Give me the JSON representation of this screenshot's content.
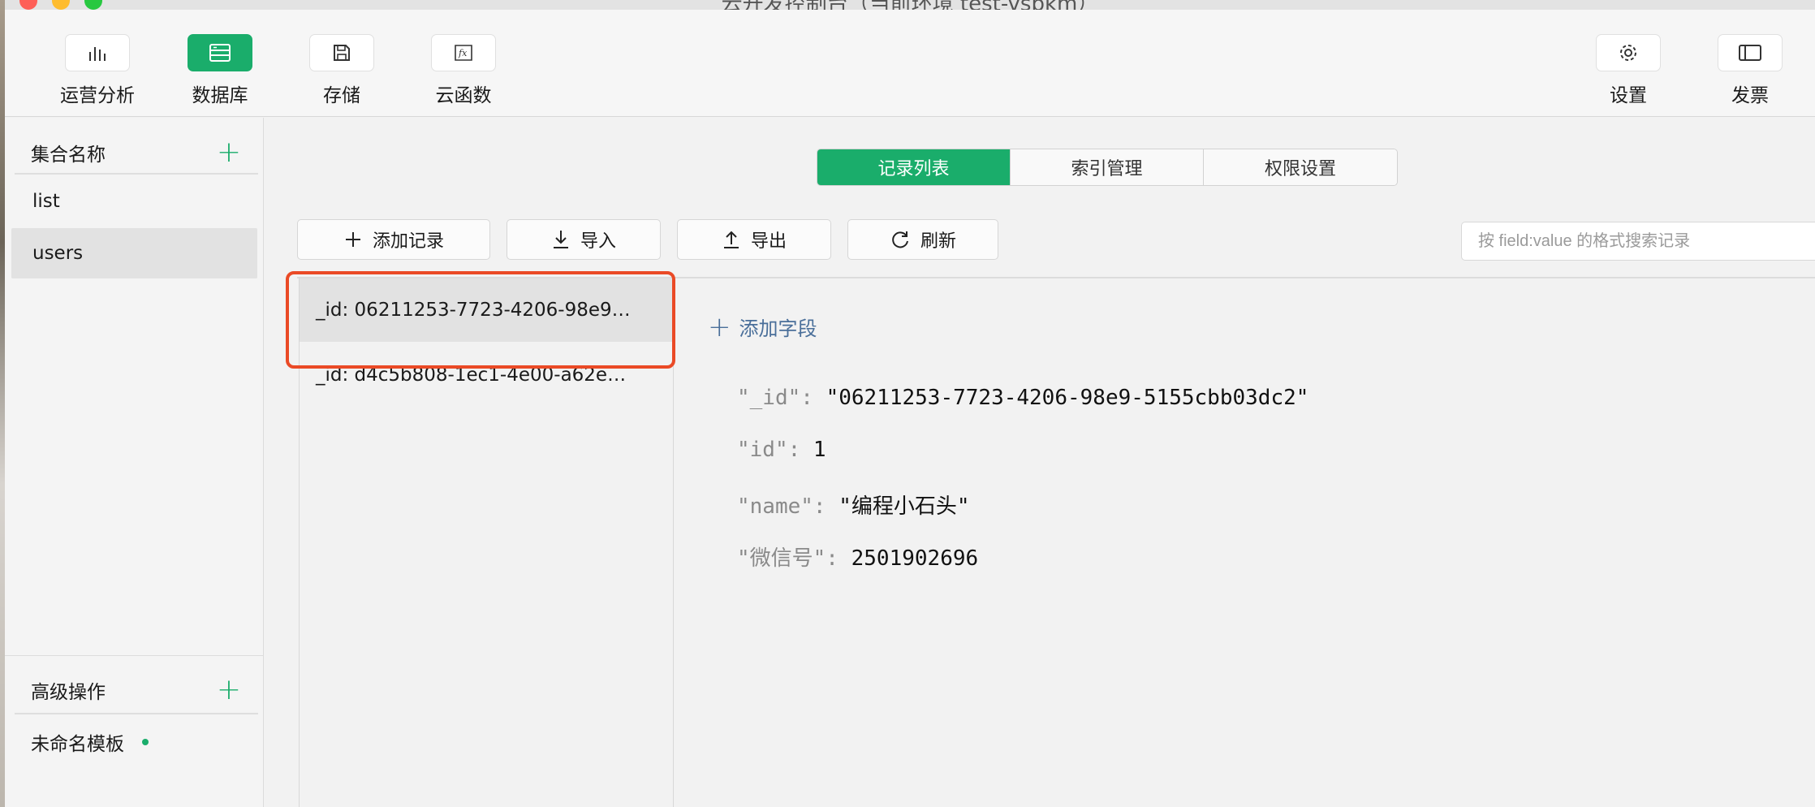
{
  "window": {
    "title": "云开发控制台（当前环境 test-vsbkm）"
  },
  "toolbar": {
    "items": [
      {
        "label": "运营分析",
        "icon": "bar-chart-icon"
      },
      {
        "label": "数据库",
        "icon": "database-icon",
        "active": true
      },
      {
        "label": "存储",
        "icon": "floppy-disk-icon"
      },
      {
        "label": "云函数",
        "icon": "function-icon"
      }
    ],
    "right_items": [
      {
        "label": "设置",
        "icon": "gear-icon"
      },
      {
        "label": "发票",
        "icon": "invoice-icon"
      }
    ]
  },
  "sidebar": {
    "collections_header": "集合名称",
    "collections": [
      {
        "label": "list"
      },
      {
        "label": "users",
        "selected": true
      }
    ],
    "advanced_header": "高级操作",
    "templates": [
      {
        "label": "未命名模板"
      }
    ]
  },
  "main": {
    "tabs": [
      {
        "label": "记录列表",
        "active": true
      },
      {
        "label": "索引管理"
      },
      {
        "label": "权限设置"
      }
    ],
    "actions": {
      "add_record": "添加记录",
      "import": "导入",
      "export": "导出",
      "refresh": "刷新"
    },
    "search_placeholder": "按 field:value 的格式搜索记录",
    "records": [
      {
        "label": "_id: 06211253-7723-4206-98e9…",
        "selected": true
      },
      {
        "label": "_id: d4c5b808-1ec1-4e00-a62e…"
      }
    ],
    "add_field_label": "添加字段",
    "fields": [
      {
        "key": "\"_id\": ",
        "value": "\"06211253-7723-4206-98e9-5155cbb03dc2\""
      },
      {
        "key": "\"id\": ",
        "value": "1"
      },
      {
        "key": "\"name\": ",
        "value": "\"编程小石头\""
      },
      {
        "key": "\"微信号\": ",
        "value": "2501902696"
      }
    ]
  },
  "colors": {
    "accent": "#1aad6b",
    "highlight": "#ea4a26",
    "link": "#4a6f9a"
  }
}
